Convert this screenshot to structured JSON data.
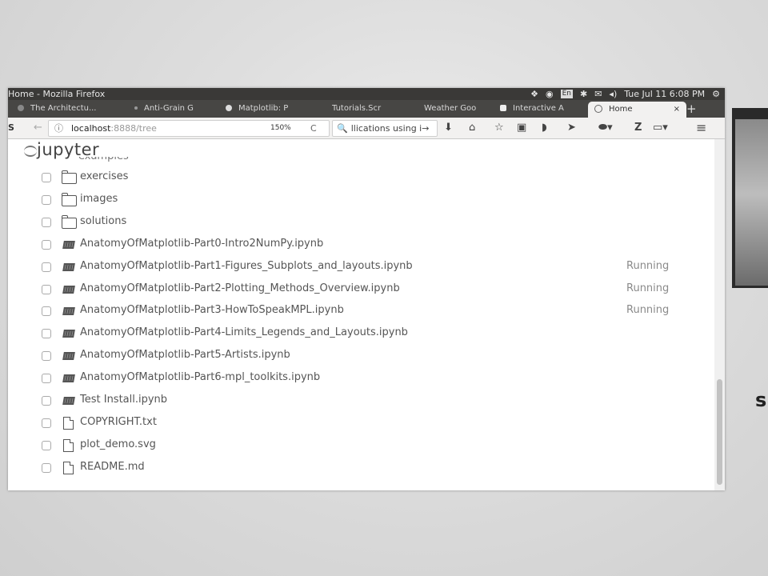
{
  "desktop": {
    "side_glyph": "s"
  },
  "window": {
    "title": "Home - Mozilla Firefox",
    "tray": {
      "lang": "En",
      "datetime": "Tue Jul 11  6:08 PM"
    },
    "tabs": [
      {
        "label": "The Architectu..."
      },
      {
        "label": "Anti-Grain G"
      },
      {
        "label": "Matplotlib: P"
      },
      {
        "label": "Tutorials.Scr"
      },
      {
        "label": "Weather Goo"
      },
      {
        "label": "Interactive A"
      },
      {
        "label": "Home",
        "active": true
      }
    ],
    "new_tab_label": "+",
    "tab_close_label": "×"
  },
  "navbar": {
    "sidebar_label": "S",
    "back_label": "←",
    "info_label": "ⓘ",
    "url_host": "localhost",
    "url_rest": ":8888/tree",
    "zoom": "150%",
    "reload_label": "C",
    "search_icon": "🔍",
    "search_text": "llications using i",
    "search_go": "→",
    "menu_label": "≡"
  },
  "notebook_list": {
    "logo_text": "jupyter",
    "partial_item": "examples",
    "items": [
      {
        "type": "folder",
        "name": "exercises",
        "status": ""
      },
      {
        "type": "folder",
        "name": "images",
        "status": ""
      },
      {
        "type": "folder",
        "name": "solutions",
        "status": ""
      },
      {
        "type": "notebook",
        "name": "AnatomyOfMatplotlib-Part0-Intro2NumPy.ipynb",
        "status": ""
      },
      {
        "type": "notebook",
        "name": "AnatomyOfMatplotlib-Part1-Figures_Subplots_and_layouts.ipynb",
        "status": "Running"
      },
      {
        "type": "notebook",
        "name": "AnatomyOfMatplotlib-Part2-Plotting_Methods_Overview.ipynb",
        "status": "Running"
      },
      {
        "type": "notebook",
        "name": "AnatomyOfMatplotlib-Part3-HowToSpeakMPL.ipynb",
        "status": "Running"
      },
      {
        "type": "notebook",
        "name": "AnatomyOfMatplotlib-Part4-Limits_Legends_and_Layouts.ipynb",
        "status": ""
      },
      {
        "type": "notebook",
        "name": "AnatomyOfMatplotlib-Part5-Artists.ipynb",
        "status": ""
      },
      {
        "type": "notebook",
        "name": "AnatomyOfMatplotlib-Part6-mpl_toolkits.ipynb",
        "status": ""
      },
      {
        "type": "notebook",
        "name": "Test Install.ipynb",
        "status": ""
      },
      {
        "type": "file",
        "name": "COPYRIGHT.txt",
        "status": ""
      },
      {
        "type": "file",
        "name": "plot_demo.svg",
        "status": ""
      },
      {
        "type": "file",
        "name": "README.md",
        "status": ""
      }
    ]
  }
}
